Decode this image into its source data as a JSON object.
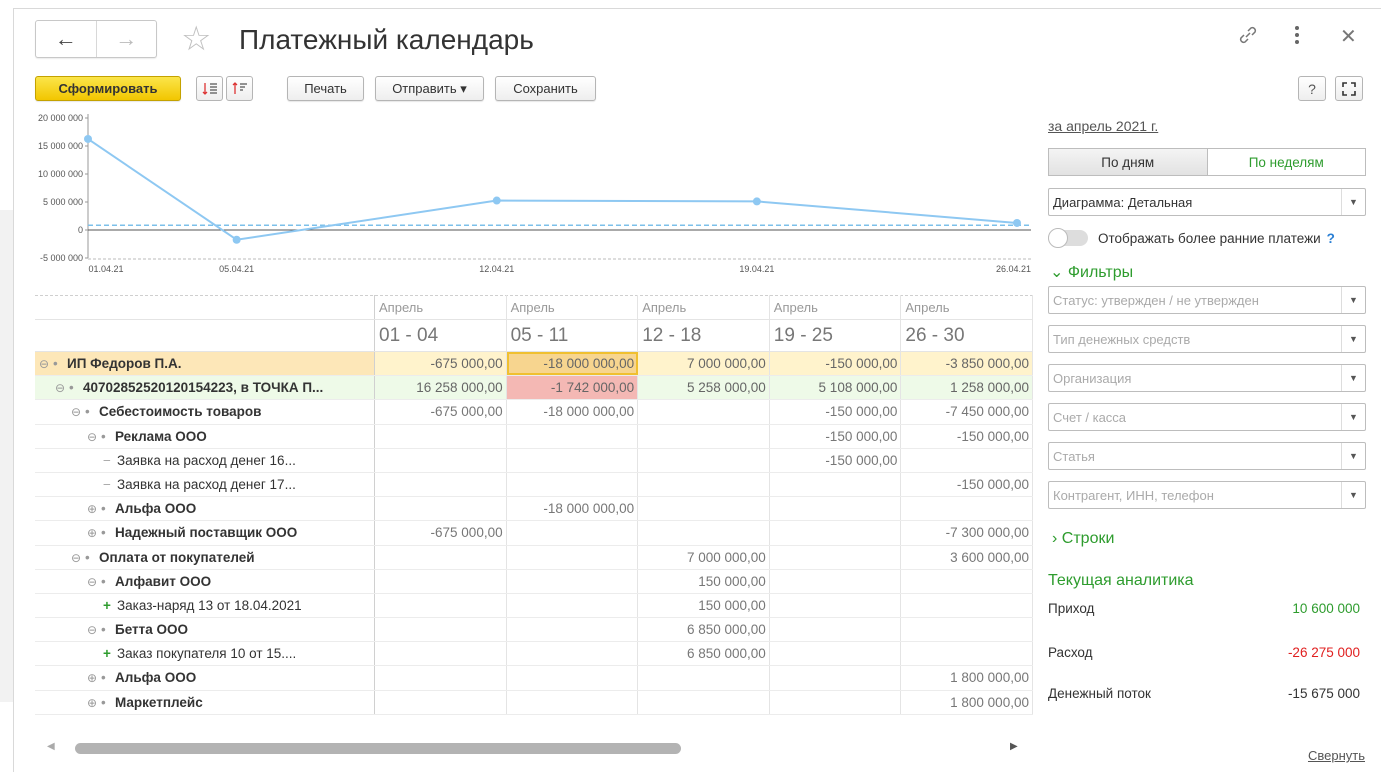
{
  "header": {
    "title": "Платежный календарь",
    "back_label": "←",
    "forward_label": "→"
  },
  "toolbar": {
    "generate": "Сформировать",
    "print": "Печать",
    "send": "Отправить ▾",
    "save": "Сохранить",
    "help": "?"
  },
  "chart_data": {
    "type": "line",
    "x": [
      "01.04.21",
      "05.04.21",
      "12.04.21",
      "19.04.21",
      "26.04.21"
    ],
    "y_ticks": [
      "20 000 000",
      "15 000 000",
      "10 000 000",
      "5 000 000",
      "0",
      "-5 000 000"
    ],
    "ylim": [
      -5000000,
      20000000
    ],
    "series": [
      {
        "values": [
          16258000,
          -1742000,
          5258000,
          5108000,
          1258000
        ],
        "color": "#8ec8f2"
      }
    ],
    "reference_line": 850000,
    "grid": false
  },
  "table": {
    "month_headers": [
      "Апрель",
      "Апрель",
      "Апрель",
      "Апрель",
      "Апрель"
    ],
    "periods": [
      "01 - 04",
      "05 - 11",
      "12 - 18",
      "19 - 25",
      "26 - 30"
    ],
    "rows": [
      {
        "label": "ИП Федоров П.А.",
        "toggle": "⊖",
        "marker": "•",
        "values": [
          "-675 000,00",
          "-18 000 000,00",
          "7 000 000,00",
          "-150 000,00",
          "-3 850 000,00"
        ]
      },
      {
        "label": "40702852520120154223, в ТОЧКА П...",
        "toggle": "⊖",
        "marker": "•",
        "values": [
          "16 258 000,00",
          "-1 742 000,00",
          "5 258 000,00",
          "5 108 000,00",
          "1 258 000,00"
        ]
      },
      {
        "label": "Себестоимость товаров",
        "toggle": "⊖",
        "marker": "•",
        "values": [
          "-675 000,00",
          "-18 000 000,00",
          "",
          "-150 000,00",
          "-7 450 000,00"
        ]
      },
      {
        "label": "Реклама ООО",
        "toggle": "⊖",
        "marker": "•",
        "values": [
          "",
          "",
          "",
          "-150 000,00",
          "-150 000,00"
        ]
      },
      {
        "label": "Заявка на расход денег 16...",
        "toggle": "",
        "marker": "−",
        "values": [
          "",
          "",
          "",
          "-150 000,00",
          ""
        ]
      },
      {
        "label": "Заявка на расход денег 17...",
        "toggle": "",
        "marker": "−",
        "values": [
          "",
          "",
          "",
          "",
          "-150 000,00"
        ]
      },
      {
        "label": "Альфа ООО",
        "toggle": "⊕",
        "marker": "•",
        "values": [
          "",
          "-18 000 000,00",
          "",
          "",
          ""
        ]
      },
      {
        "label": "Надежный поставщик ООО",
        "toggle": "⊕",
        "marker": "•",
        "values": [
          "-675 000,00",
          "",
          "",
          "",
          "-7 300 000,00"
        ]
      },
      {
        "label": "Оплата от покупателей",
        "toggle": "⊖",
        "marker": "•",
        "values": [
          "",
          "",
          "7 000 000,00",
          "",
          "3 600 000,00"
        ]
      },
      {
        "label": "Алфавит ООО",
        "toggle": "⊖",
        "marker": "•",
        "values": [
          "",
          "",
          "150 000,00",
          "",
          ""
        ]
      },
      {
        "label": "Заказ-наряд 13 от 18.04.2021",
        "toggle": "",
        "marker": "+",
        "values": [
          "",
          "",
          "150 000,00",
          "",
          ""
        ]
      },
      {
        "label": "Бетта ООО",
        "toggle": "⊖",
        "marker": "•",
        "values": [
          "",
          "",
          "6 850 000,00",
          "",
          ""
        ]
      },
      {
        "label": "Заказ покупателя 10 от 15....",
        "toggle": "",
        "marker": "+",
        "values": [
          "",
          "",
          "6 850 000,00",
          "",
          ""
        ]
      },
      {
        "label": "Альфа ООО",
        "toggle": "⊕",
        "marker": "•",
        "values": [
          "",
          "",
          "",
          "",
          "1 800 000,00"
        ]
      },
      {
        "label": "Маркетплейс",
        "toggle": "⊕",
        "marker": "•",
        "values": [
          "",
          "",
          "",
          "",
          "1 800 000,00"
        ]
      }
    ]
  },
  "panel": {
    "period_link": "за апрель 2021 г.",
    "by_days": "По дням",
    "by_weeks": "По неделям",
    "diagram_select": "Диаграмма: Детальная",
    "show_earlier": "Отображать более ранние платежи",
    "show_earlier_help": "?",
    "filters_title": "Фильтры",
    "filter_placeholders": [
      "Статус: утвержден / не утвержден",
      "Тип денежных средств",
      "Организация",
      "Счет / касса",
      "Статья",
      "Контрагент, ИНН, телефон"
    ],
    "rows_title": "Строки",
    "analytics_title": "Текущая аналитика",
    "income_label": "Приход",
    "income_value": "10 600 000",
    "expense_label": "Расход",
    "expense_value": "-26 275 000",
    "cashflow_label": "Денежный поток",
    "cashflow_value": "-15 675 000",
    "collapse_link": "Свернуть"
  }
}
